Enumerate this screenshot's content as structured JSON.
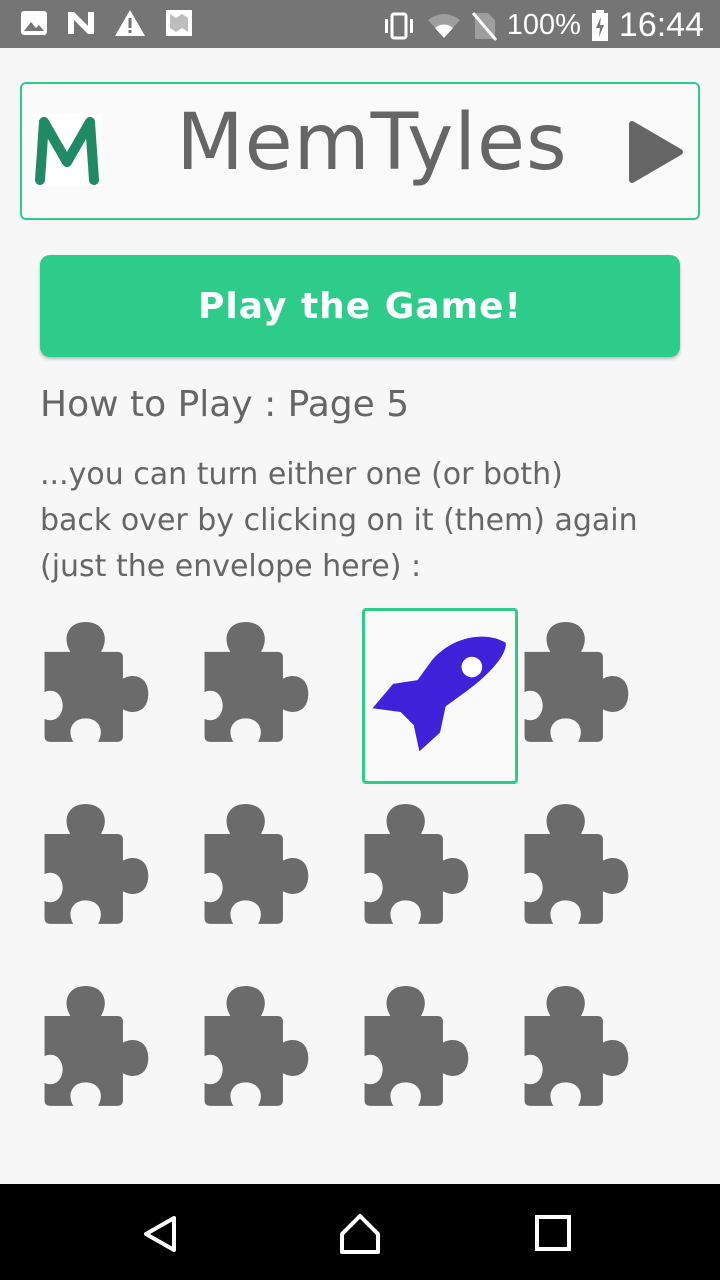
{
  "status_bar": {
    "battery_percent": "100%",
    "time": "16:44",
    "left_icons": [
      "image-icon",
      "n-app-icon",
      "warning-icon",
      "map-icon"
    ],
    "right_icons": [
      "vibrate-icon",
      "wifi-icon",
      "no-sim-icon",
      "battery-charging-icon"
    ]
  },
  "header": {
    "logo_letter": "M",
    "title": "MemTyles",
    "play_icon": "play-icon"
  },
  "play_button": {
    "label": "Play the Game!"
  },
  "how_to_play": {
    "title": "How to Play : Page 5",
    "lines": [
      "...you can turn either one (or both)",
      "back over by clicking on it (them) again",
      "(just the envelope here) :"
    ]
  },
  "tiles": [
    {
      "face": "puzzle-piece-icon",
      "revealed": false
    },
    {
      "face": "puzzle-piece-icon",
      "revealed": false
    },
    {
      "face": "rocket-icon",
      "revealed": true
    },
    {
      "face": "puzzle-piece-icon",
      "revealed": false
    },
    {
      "face": "puzzle-piece-icon",
      "revealed": false
    },
    {
      "face": "puzzle-piece-icon",
      "revealed": false
    },
    {
      "face": "puzzle-piece-icon",
      "revealed": false
    },
    {
      "face": "puzzle-piece-icon",
      "revealed": false
    },
    {
      "face": "puzzle-piece-icon",
      "revealed": false
    },
    {
      "face": "puzzle-piece-icon",
      "revealed": false
    },
    {
      "face": "puzzle-piece-icon",
      "revealed": false
    },
    {
      "face": "puzzle-piece-icon",
      "revealed": false
    }
  ],
  "colors": {
    "accent": "#2ecc8b",
    "tile_back": "#6b6b6b",
    "rocket": "#3f22d9",
    "logo": "#1f8a63"
  },
  "nav_bar": {
    "buttons": [
      "back-icon",
      "home-icon",
      "recents-icon"
    ]
  }
}
